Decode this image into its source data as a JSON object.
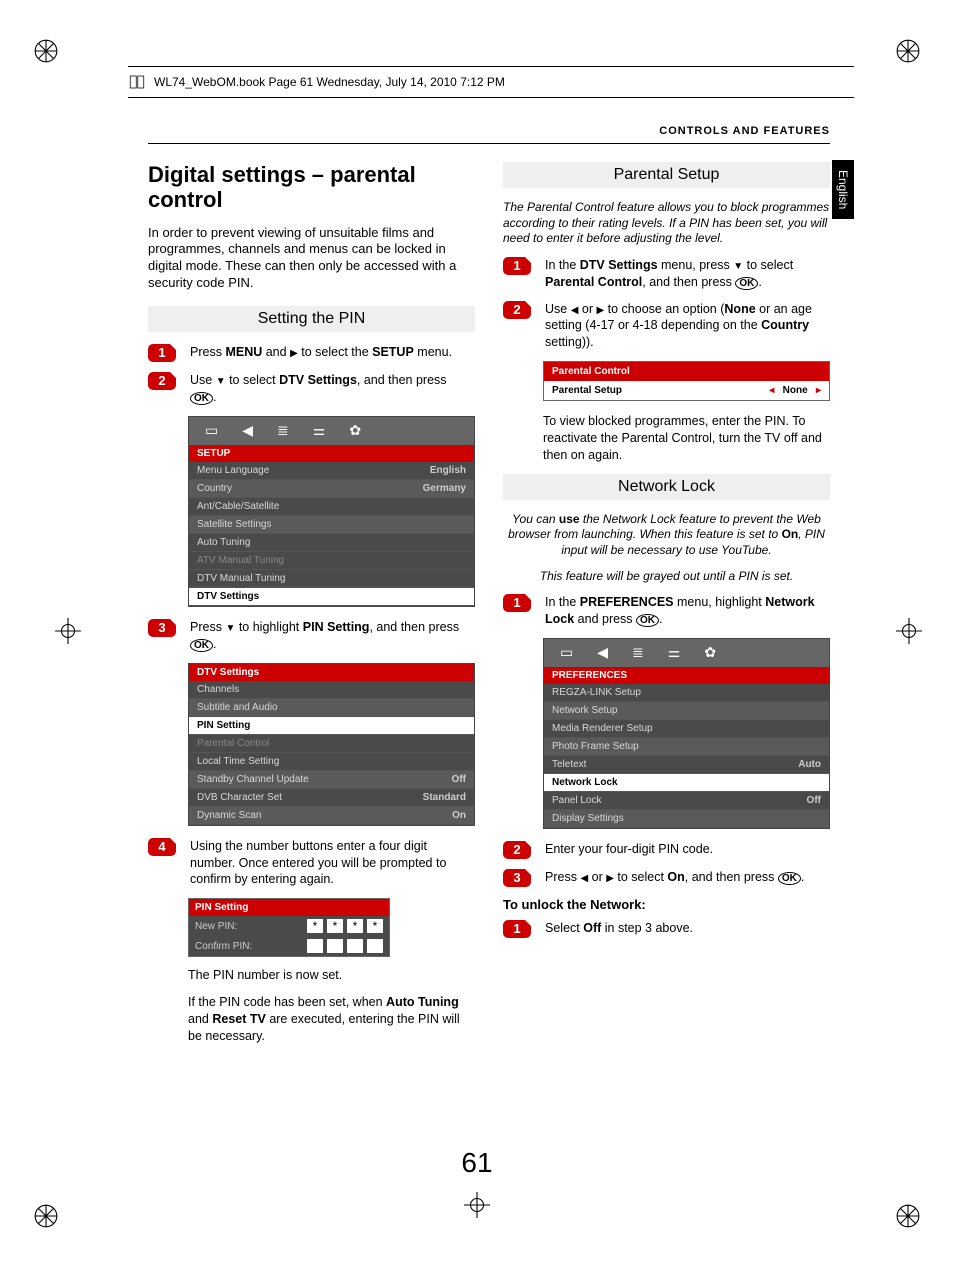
{
  "printer_header": "WL74_WebOM.book  Page 61  Wednesday, July 14, 2010  7:12 PM",
  "running_head": "CONTROLS AND FEATURES",
  "side_tab": "English",
  "page_number": "61",
  "left": {
    "title": "Digital settings – parental control",
    "intro": "In order to prevent viewing of unsuitable films and programmes, channels and menus can be locked in digital mode. These can then only be accessed with a security code PIN.",
    "section1": "Setting the PIN",
    "step1_a": "Press ",
    "step1_b": "MENU",
    "step1_c": " and ",
    "step1_d": " to select the ",
    "step1_e": "SETUP",
    "step1_f": " menu.",
    "step2_a": "Use ",
    "step2_b": " to select ",
    "step2_c": "DTV Settings",
    "step2_d": ", and then press ",
    "step3_a": "Press ",
    "step3_b": " to highlight ",
    "step3_c": "PIN Setting",
    "step3_d": ", and then press ",
    "step4": "Using the number buttons enter a four digit number. Once entered you will be prompted to confirm by entering again.",
    "note_after_pin_1": "The PIN number is now set.",
    "note_after_pin_2a": "If the PIN code has been set, when ",
    "note_after_pin_2b": "Auto Tuning",
    "note_after_pin_2c": " and ",
    "note_after_pin_2d": "Reset TV",
    "note_after_pin_2e": " are executed, entering the PIN will be necessary.",
    "osd_setup": {
      "header": "SETUP",
      "rows": [
        {
          "l": "Menu Language",
          "r": "English"
        },
        {
          "l": "Country",
          "r": "Germany"
        },
        {
          "l": "Ant/Cable/Satellite",
          "r": ""
        },
        {
          "l": "Satellite Settings",
          "r": ""
        },
        {
          "l": "Auto Tuning",
          "r": ""
        },
        {
          "l": "ATV Manual Tuning",
          "r": ""
        },
        {
          "l": "DTV Manual Tuning",
          "r": ""
        },
        {
          "l": "DTV Settings",
          "r": ""
        }
      ]
    },
    "osd_dtv": {
      "header": "DTV Settings",
      "rows": [
        {
          "l": "Channels",
          "r": ""
        },
        {
          "l": "Subtitle and Audio",
          "r": ""
        },
        {
          "l": "PIN Setting",
          "r": ""
        },
        {
          "l": "Parental Control",
          "r": ""
        },
        {
          "l": "Local Time Setting",
          "r": ""
        },
        {
          "l": "Standby Channel Update",
          "r": "Off"
        },
        {
          "l": "DVB Character Set",
          "r": "Standard"
        },
        {
          "l": "Dynamic Scan",
          "r": "On"
        }
      ]
    },
    "pin_box": {
      "header": "PIN Setting",
      "new": "New PIN:",
      "confirm": "Confirm PIN:"
    }
  },
  "right": {
    "section1": "Parental Setup",
    "intro_italic": "The Parental Control feature allows you to block programmes according to their rating levels. If a PIN has been set, you will need to enter it before adjusting the level.",
    "step1_a": "In the ",
    "step1_b": "DTV Settings",
    "step1_c": " menu, press ",
    "step1_d": " to select ",
    "step1_e": "Parental Control",
    "step1_f": ", and then press ",
    "step2_a": "Use ",
    "step2_b": " or ",
    "step2_c": " to choose an option (",
    "step2_d": "None",
    "step2_e": " or an age setting (4-17 or 4-18 depending on the ",
    "step2_f": "Country",
    "step2_g": " setting)).",
    "parental_bar": {
      "h": "Parental Control",
      "l": "Parental Setup",
      "v": "None"
    },
    "note_reactivate": "To view blocked programmes, enter the PIN. To reactivate the Parental Control, turn the TV off and then on again.",
    "section2": "Network Lock",
    "nl_intro_a": "You can ",
    "nl_intro_b": "use",
    "nl_intro_c": " the Network Lock feature to prevent the Web browser from launching. When this feature is set to ",
    "nl_intro_d": "On",
    "nl_intro_e": ", PIN input will be necessary to use YouTube.",
    "nl_intro2": "This feature will be grayed out until a PIN is set.",
    "nl_step1_a": "In the ",
    "nl_step1_b": "PREFERENCES",
    "nl_step1_c": " menu, highlight ",
    "nl_step1_d": "Network Lock",
    "nl_step1_e": " and press ",
    "osd_pref": {
      "header": "PREFERENCES",
      "rows": [
        {
          "l": "REGZA-LINK Setup",
          "r": ""
        },
        {
          "l": "Network Setup",
          "r": ""
        },
        {
          "l": "Media Renderer Setup",
          "r": ""
        },
        {
          "l": "Photo Frame Setup",
          "r": ""
        },
        {
          "l": "Teletext",
          "r": "Auto"
        },
        {
          "l": "Network Lock",
          "r": ""
        },
        {
          "l": "Panel Lock",
          "r": "Off"
        },
        {
          "l": "Display Settings",
          "r": ""
        }
      ]
    },
    "nl_step2": "Enter your four-digit PIN code.",
    "nl_step3_a": "Press ",
    "nl_step3_b": " or ",
    "nl_step3_c": " to select ",
    "nl_step3_d": "On",
    "nl_step3_e": ", and then press ",
    "unlock_head": "To unlock the Network:",
    "unlock_step1_a": "Select ",
    "unlock_step1_b": "Off",
    "unlock_step1_c": " in step 3 above."
  }
}
